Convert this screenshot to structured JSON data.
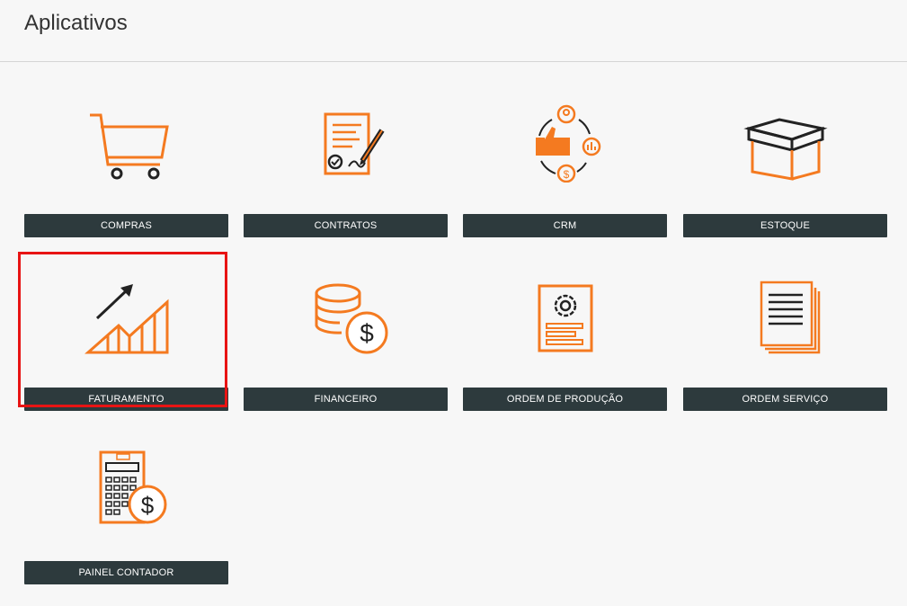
{
  "page": {
    "title": "Aplicativos"
  },
  "colors": {
    "accent": "#f47a20",
    "label_bg": "#2d3a3d",
    "selected": "#e81414"
  },
  "apps": [
    {
      "label": "COMPRAS",
      "icon": "shopping-cart-icon"
    },
    {
      "label": "CONTRATOS",
      "icon": "contract-signature-icon"
    },
    {
      "label": "CRM",
      "icon": "crm-cycle-icon"
    },
    {
      "label": "ESTOQUE",
      "icon": "box-icon"
    },
    {
      "label": "FATURAMENTO",
      "icon": "growth-chart-icon",
      "selected": true
    },
    {
      "label": "FINANCEIRO",
      "icon": "coins-dollar-icon"
    },
    {
      "label": "ORDEM DE PRODUÇÃO",
      "icon": "production-order-icon"
    },
    {
      "label": "ORDEM SERVIÇO",
      "icon": "service-documents-icon"
    },
    {
      "label": "PAINEL CONTADOR",
      "icon": "calculator-dollar-icon"
    }
  ]
}
